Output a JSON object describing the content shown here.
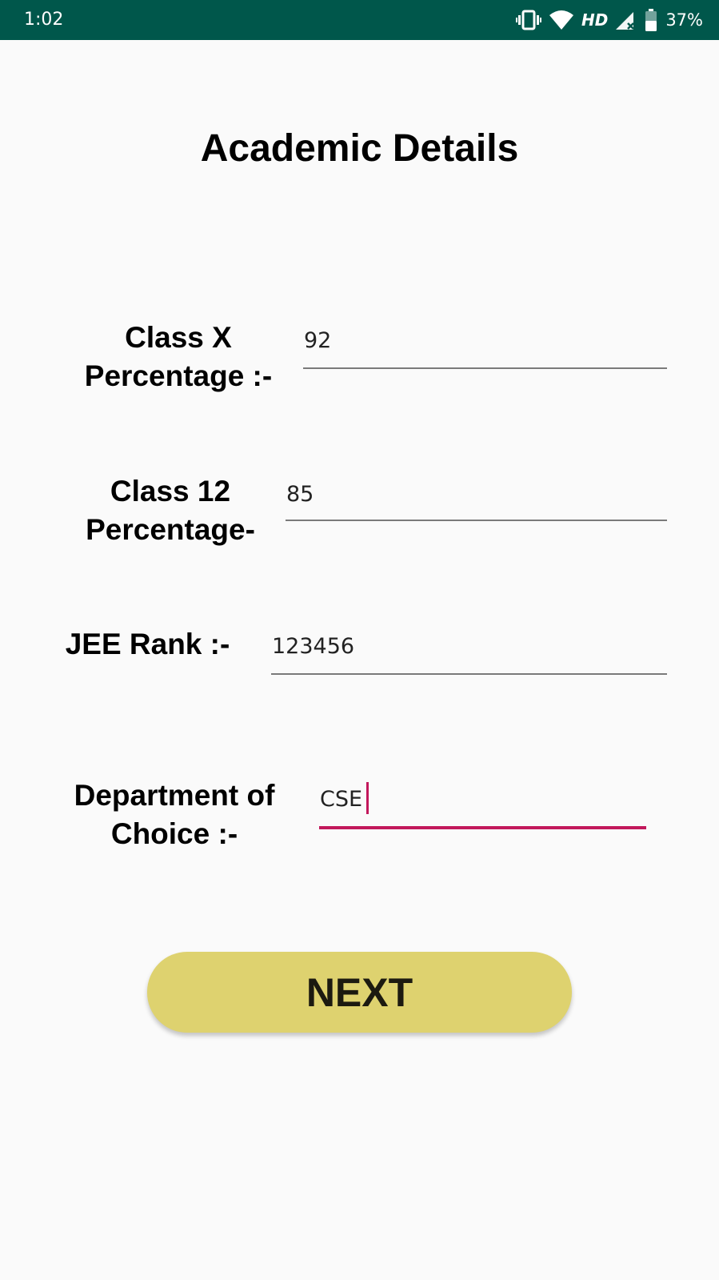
{
  "status_bar": {
    "time": "1:02",
    "network_label": "HD",
    "battery": "37%",
    "icons": [
      "vibrate-icon",
      "wifi-icon",
      "signal-icon",
      "battery-icon"
    ],
    "background": "#00574b"
  },
  "page": {
    "title": "Academic Details"
  },
  "form": {
    "class_x": {
      "label_line1": "Class X",
      "label_line2": "Percentage :-",
      "value": "92"
    },
    "class_12": {
      "label_line1": "Class 12",
      "label_line2": "Percentage-",
      "value": "85"
    },
    "jee_rank": {
      "label": "JEE Rank :-",
      "value": "123456"
    },
    "department": {
      "label_line1": "Department of",
      "label_line2": "Choice :-",
      "value": "CSE"
    }
  },
  "next_button": {
    "label": "NEXT",
    "color": "#ded26f"
  },
  "colors": {
    "accent": "#c2185b",
    "background": "#fafafa"
  }
}
